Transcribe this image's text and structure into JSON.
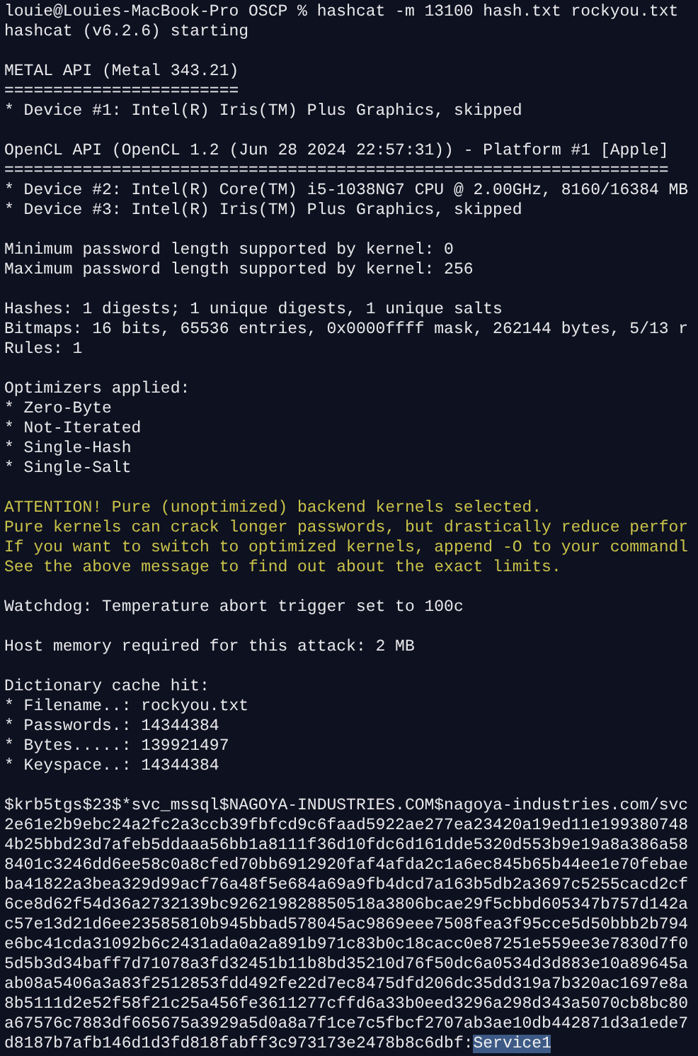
{
  "terminal": {
    "lines": [
      {
        "kind": "text",
        "text": "louie@Louies-MacBook-Pro OSCP % hashcat -m 13100 hash.txt rockyou.txt"
      },
      {
        "kind": "text",
        "text": "hashcat (v6.2.6) starting"
      },
      {
        "kind": "blank"
      },
      {
        "kind": "text",
        "text": "METAL API (Metal 343.21)"
      },
      {
        "kind": "text",
        "text": "========================"
      },
      {
        "kind": "text",
        "text": "* Device #1: Intel(R) Iris(TM) Plus Graphics, skipped"
      },
      {
        "kind": "blank"
      },
      {
        "kind": "text",
        "text": "OpenCL API (OpenCL 1.2 (Jun 28 2024 22:57:31)) - Platform #1 [Apple]"
      },
      {
        "kind": "text",
        "text": "===================================================================="
      },
      {
        "kind": "text",
        "text": "* Device #2: Intel(R) Core(TM) i5-1038NG7 CPU @ 2.00GHz, 8160/16384 MB"
      },
      {
        "kind": "text",
        "text": "* Device #3: Intel(R) Iris(TM) Plus Graphics, skipped"
      },
      {
        "kind": "blank"
      },
      {
        "kind": "text",
        "text": "Minimum password length supported by kernel: 0"
      },
      {
        "kind": "text",
        "text": "Maximum password length supported by kernel: 256"
      },
      {
        "kind": "blank"
      },
      {
        "kind": "text",
        "text": "Hashes: 1 digests; 1 unique digests, 1 unique salts"
      },
      {
        "kind": "text",
        "text": "Bitmaps: 16 bits, 65536 entries, 0x0000ffff mask, 262144 bytes, 5/13 r"
      },
      {
        "kind": "text",
        "text": "Rules: 1"
      },
      {
        "kind": "blank"
      },
      {
        "kind": "text",
        "text": "Optimizers applied:"
      },
      {
        "kind": "text",
        "text": "* Zero-Byte"
      },
      {
        "kind": "text",
        "text": "* Not-Iterated"
      },
      {
        "kind": "text",
        "text": "* Single-Hash"
      },
      {
        "kind": "text",
        "text": "* Single-Salt"
      },
      {
        "kind": "blank"
      },
      {
        "kind": "warning",
        "text": "ATTENTION! Pure (unoptimized) backend kernels selected."
      },
      {
        "kind": "warning",
        "text": "Pure kernels can crack longer passwords, but drastically reduce perfor"
      },
      {
        "kind": "warning",
        "text": "If you want to switch to optimized kernels, append -O to your commandl"
      },
      {
        "kind": "warning",
        "text": "See the above message to find out about the exact limits."
      },
      {
        "kind": "blank"
      },
      {
        "kind": "text",
        "text": "Watchdog: Temperature abort trigger set to 100c"
      },
      {
        "kind": "blank"
      },
      {
        "kind": "text",
        "text": "Host memory required for this attack: 2 MB"
      },
      {
        "kind": "blank"
      },
      {
        "kind": "text",
        "text": "Dictionary cache hit:"
      },
      {
        "kind": "text",
        "text": "* Filename..: rockyou.txt"
      },
      {
        "kind": "text",
        "text": "* Passwords.: 14344384"
      },
      {
        "kind": "text",
        "text": "* Bytes.....: 139921497"
      },
      {
        "kind": "text",
        "text": "* Keyspace..: 14344384"
      },
      {
        "kind": "blank"
      },
      {
        "kind": "text",
        "text": "$krb5tgs$23$*svc_mssql$NAGOYA-INDUSTRIES.COM$nagoya-industries.com/svc"
      },
      {
        "kind": "text",
        "text": "2e61e2b9ebc24a2fc2a3ccb39fbfcd9c6faad5922ae277ea23420a19ed11e199380748"
      },
      {
        "kind": "text",
        "text": "4b25bbd23d7afeb5ddaaa56bb1a8111f36d10fdc6d161dde5320d553b9e19a8a386a58"
      },
      {
        "kind": "text",
        "text": "8401c3246dd6ee58c0a8cfed70bb6912920faf4afda2c1a6ec845b65b44ee1e70febae"
      },
      {
        "kind": "text",
        "text": "ba41822a3bea329d99acf76a48f5e684a69a9fb4dcd7a163b5db2a3697c5255cacd2cf"
      },
      {
        "kind": "text",
        "text": "6ce8d62f54d36a2732139bc926219828850518a3806bcae29f5cbbd605347b757d142a"
      },
      {
        "kind": "text",
        "text": "c57e13d21d6ee23585810b945bbad578045ac9869eee7508fea3f95cce5d50bbb2b794"
      },
      {
        "kind": "text",
        "text": "e6bc41cda31092b6c2431ada0a2a891b971c83b0c18cacc0e87251e559ee3e7830d7f0"
      },
      {
        "kind": "text",
        "text": "5d5b3d34baff7d71078a3fd32451b11b8bd35210d76f50dc6a0534d3d883e10a89645a"
      },
      {
        "kind": "text",
        "text": "ab08a5406a3a83f2512853fdd492fe22d7ec8475dfd206dc35dd319a7b320ac1697e8a"
      },
      {
        "kind": "text",
        "text": "8b5111d2e52f58f21c25a456fe3611277cffd6a33b0eed3296a298d343a5070cb8bc80"
      },
      {
        "kind": "text",
        "text": "a67576c7883df665675a3929a5d0a8a7f1ce7c5fbcf2707ab3ae10db442871d3a1ede7"
      },
      {
        "kind": "cracked",
        "text": "d8187b7afb146d1d3fd818fabff3c973173e2478b8c6dbf:",
        "password": "Service1",
        "selected": true
      }
    ]
  }
}
